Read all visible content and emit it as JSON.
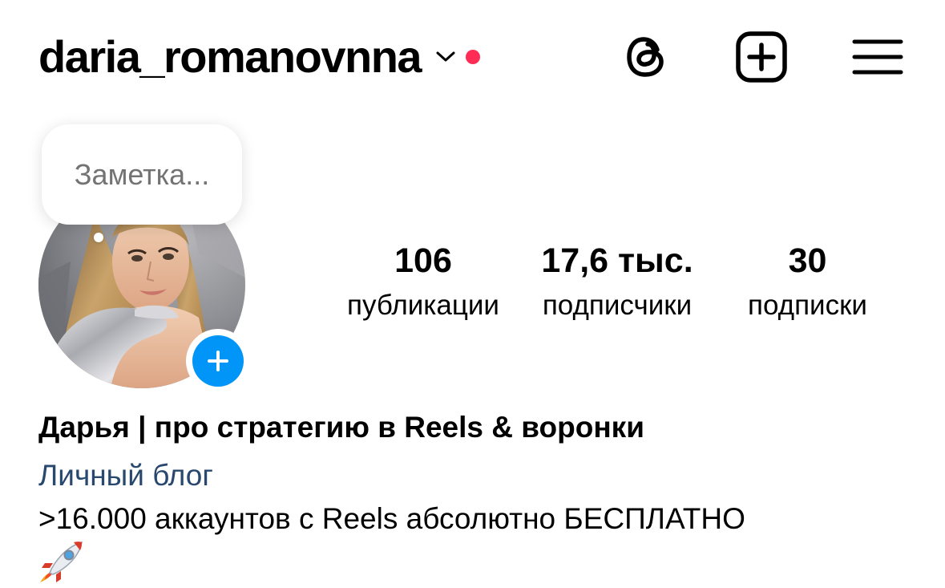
{
  "header": {
    "username": "daria_romanovnna",
    "icons": {
      "account_switch": "chevron-down-icon",
      "notification": "red-dot-icon",
      "threads": "threads-icon",
      "create": "plus-square-icon",
      "menu": "hamburger-menu-icon"
    },
    "notification_color": "#ff2c55"
  },
  "note": {
    "placeholder": "Заметка..."
  },
  "profile": {
    "add_story_icon": "plus-icon",
    "add_story_color": "#0095f6"
  },
  "stats": [
    {
      "value": "106",
      "label": "публикации"
    },
    {
      "value": "17,6 тыс.",
      "label": "подписчики"
    },
    {
      "value": "30",
      "label": "подписки"
    }
  ],
  "bio": {
    "name": "Дарья | про стратегию в Reels & воронки",
    "category": "Личный блог",
    "category_color": "#28486e",
    "text": ">16.000 аккаунтов с Reels абсолютно БЕСПЛАТНО",
    "emoji_icon": "rocket-emoji-icon"
  }
}
